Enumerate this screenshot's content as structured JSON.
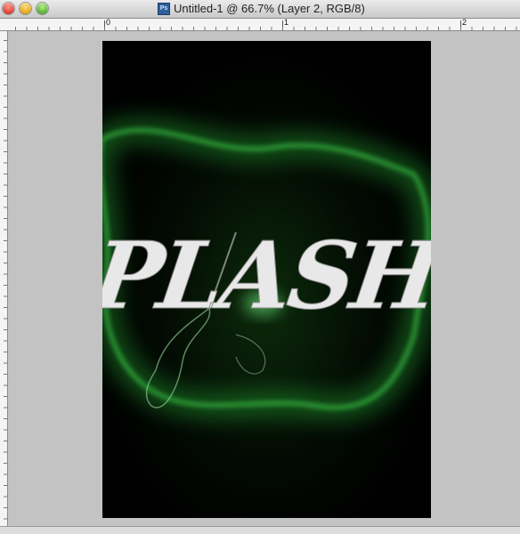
{
  "window": {
    "title": "Untitled-1 @ 66.7% (Layer 2, RGB/8)",
    "doc_icon_label": "Ps",
    "controls": [
      "close",
      "minimize",
      "zoom"
    ]
  },
  "ruler": {
    "top_labels": [
      "0",
      "1",
      "2"
    ]
  },
  "canvas": {
    "artwork_text": "SPLASH",
    "background_color": "#000000",
    "glow_color": "#2ecc40",
    "text_color": "#e8e8e8"
  }
}
